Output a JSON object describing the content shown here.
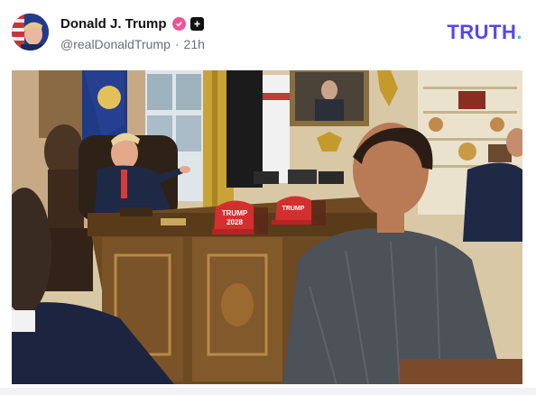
{
  "post": {
    "author_name": "Donald J. Trump",
    "handle": "@realDonaldTrump",
    "separator": "·",
    "timestamp": "21h"
  },
  "brand": {
    "logo_text": "TRUTH",
    "logo_period": ".",
    "accent_color": "#5448ee",
    "period_color": "#3cc8c8"
  },
  "icons": {
    "verified": "verified-check-icon",
    "badge": "plus-badge-icon"
  },
  "photo": {
    "hat_text_top": "TRUMP",
    "hat_text_bottom": "2028"
  }
}
